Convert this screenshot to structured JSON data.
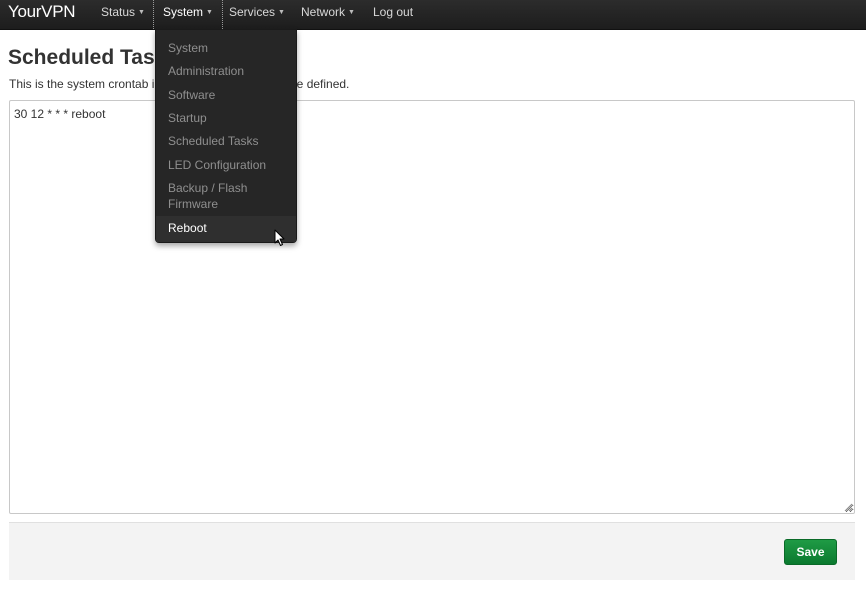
{
  "brand": "YourVPN",
  "nav": [
    {
      "label": "Status",
      "has_caret": true
    },
    {
      "label": "System",
      "has_caret": true,
      "active": true
    },
    {
      "label": "Services",
      "has_caret": true
    },
    {
      "label": "Network",
      "has_caret": true
    },
    {
      "label": "Log out",
      "has_caret": false
    }
  ],
  "system_menu": [
    {
      "label": "System"
    },
    {
      "label": "Administration"
    },
    {
      "label": "Software"
    },
    {
      "label": "Startup"
    },
    {
      "label": "Scheduled Tasks"
    },
    {
      "label": "LED Configuration"
    },
    {
      "label": "Backup / Flash Firmware"
    },
    {
      "label": "Reboot",
      "hovered": true
    }
  ],
  "page": {
    "title": "Scheduled Tas",
    "description_start": "This is the system crontab i",
    "description_end": "n be defined."
  },
  "crontab": {
    "value": "30 12 * * * reboot"
  },
  "actions": {
    "save_label": "Save"
  },
  "colors": {
    "navbar": "#222222",
    "dropdown": "#262626",
    "save_button": "#15883a"
  },
  "icons": {
    "caret": "chevron-down-icon",
    "cursor": "mouse-pointer-icon",
    "resize": "resize-grip-icon"
  }
}
